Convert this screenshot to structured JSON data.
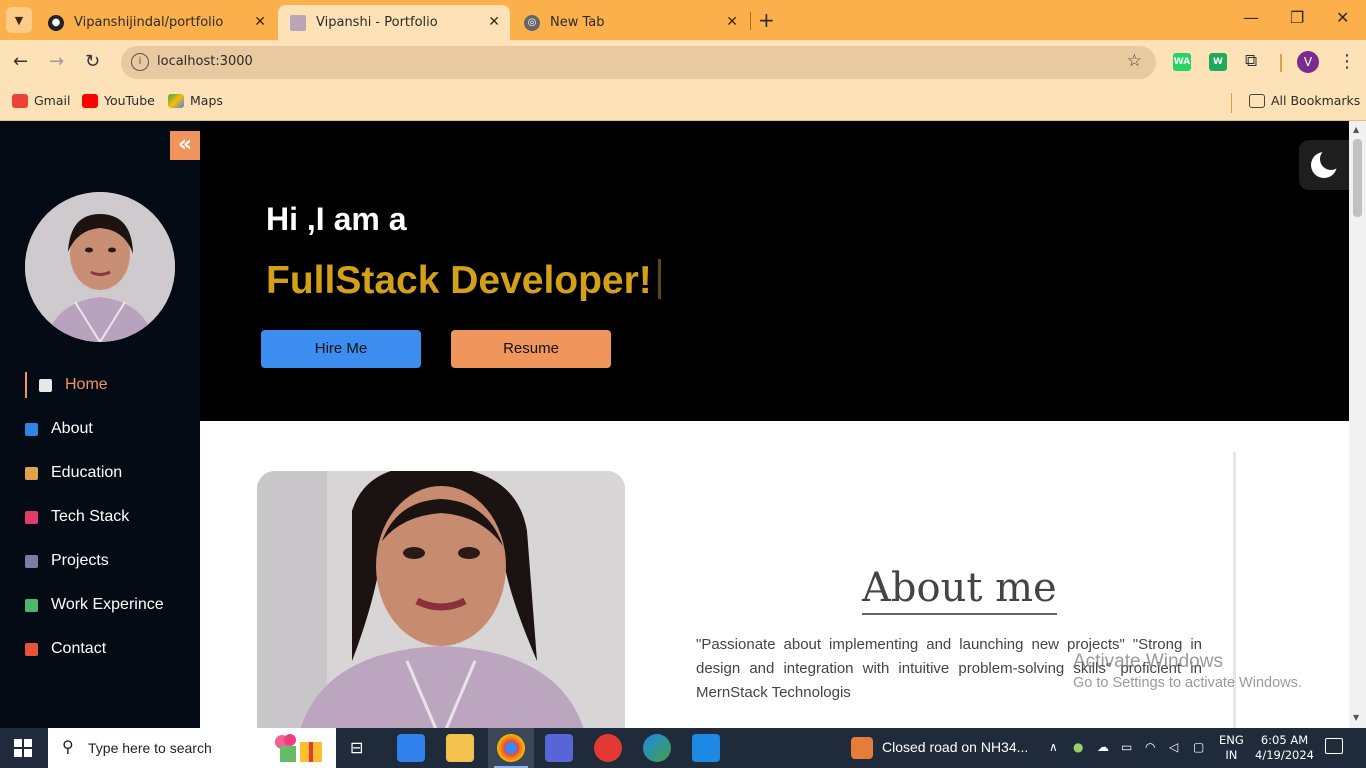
{
  "browser": {
    "tabs": [
      {
        "title": "Vipanshijindal/portfolio",
        "active": false
      },
      {
        "title": "Vipanshi - Portfolio",
        "active": true
      },
      {
        "title": "New Tab",
        "active": false
      }
    ],
    "url": "localhost:3000",
    "profile_initial": "V",
    "extensions": [
      {
        "name": "whatsapp-extension-icon",
        "label": "WA",
        "color": "#25d366"
      },
      {
        "name": "w-extension-icon",
        "label": "W",
        "color": "#1faa59"
      }
    ],
    "bookmarks": [
      {
        "label": "Gmail"
      },
      {
        "label": "YouTube"
      },
      {
        "label": "Maps"
      }
    ],
    "all_bookmarks": "All Bookmarks"
  },
  "sidebar": {
    "collapse_icon": "«",
    "items": [
      {
        "label": "Home",
        "active": true
      },
      {
        "label": "About"
      },
      {
        "label": "Education"
      },
      {
        "label": "Tech Stack"
      },
      {
        "label": "Projects"
      },
      {
        "label": "Work Experince"
      },
      {
        "label": "Contact"
      }
    ]
  },
  "hero": {
    "greeting": "Hi ,I am a",
    "role": "FullStack Developer!",
    "hire_button": "Hire Me",
    "resume_button": "Resume"
  },
  "about": {
    "title": "About me",
    "text": "\"Passionate about implementing and launching new projects\" \"Strong in design and integration with intuitive problem-solving skills\" proficient in MernStack Technologis"
  },
  "watermark": {
    "line1": "Activate Windows",
    "line2": "Go to Settings to activate Windows."
  },
  "taskbar": {
    "search_placeholder": "Type here to search",
    "news": "Closed road on NH34...",
    "lang_line1": "ENG",
    "lang_line2": "IN",
    "time": "6:05 AM",
    "date": "4/19/2024"
  },
  "colors": {
    "tabstrip": "#fbb04c",
    "toolbar": "#fde2b8",
    "accent_orange": "#f0935c",
    "hire_blue": "#3b8df0",
    "role_gold": "#d4a017",
    "sidebar_bg": "#050b14"
  }
}
